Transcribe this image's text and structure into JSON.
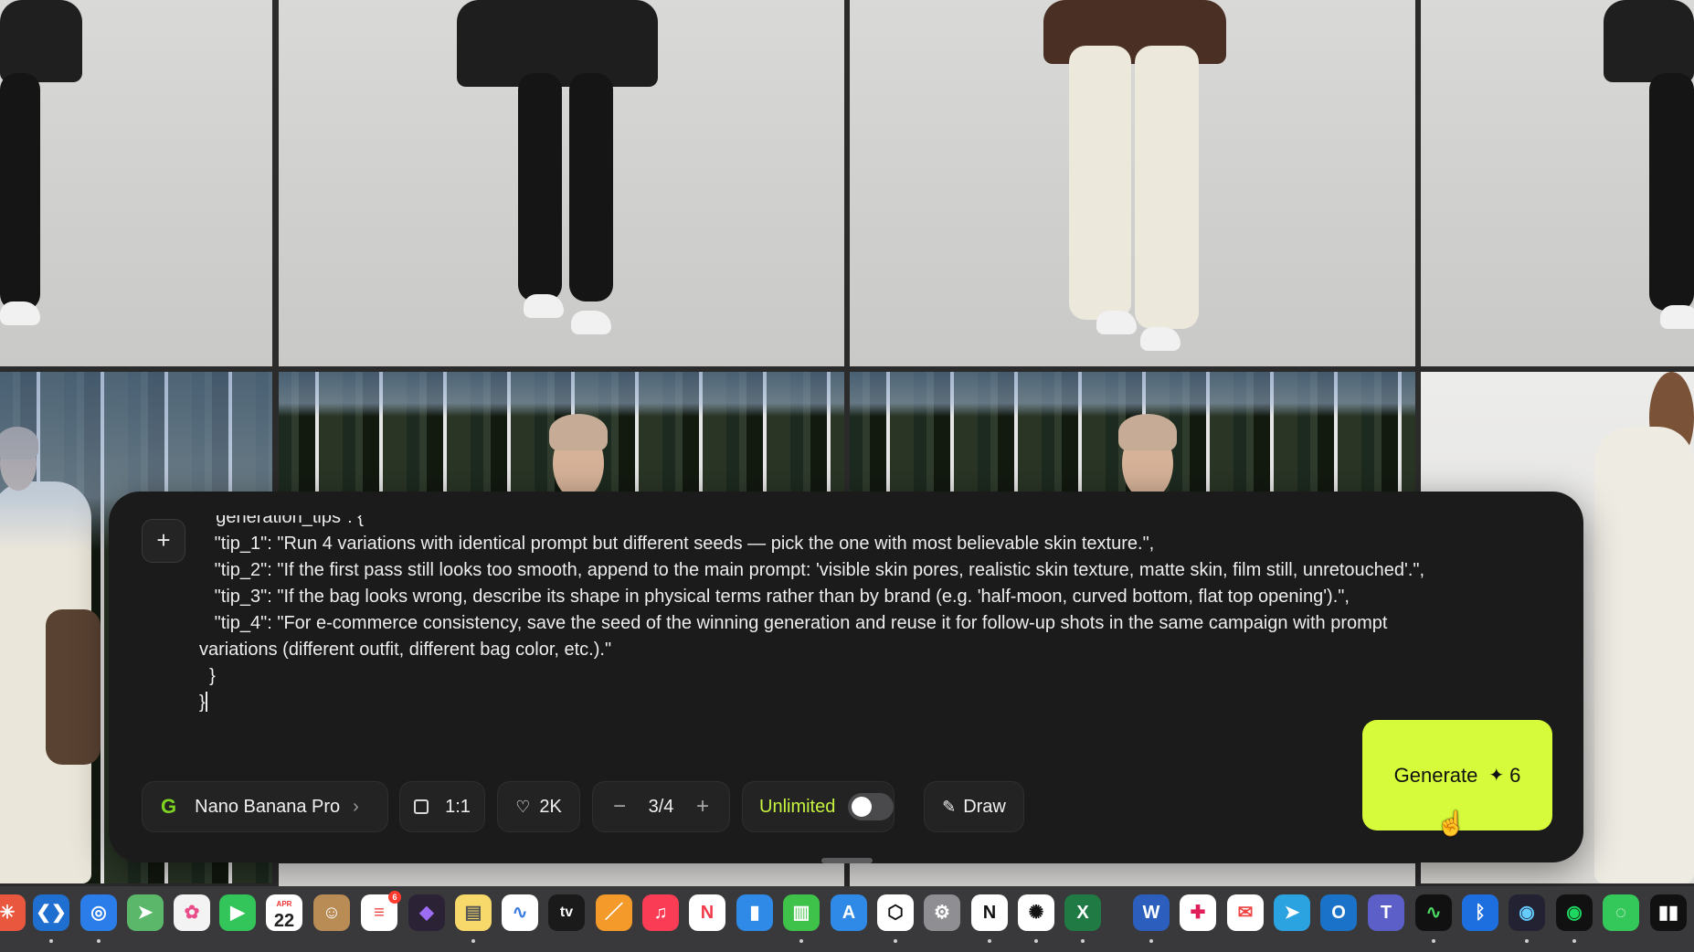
{
  "prompt": {
    "add_label": "+",
    "text": "  \"generation_tips\": {\n   \"tip_1\": \"Run 4 variations with identical prompt but different seeds — pick the one with most believable skin texture.\",\n   \"tip_2\": \"If the first pass still looks too smooth, append to the main prompt: 'visible skin pores, realistic skin texture, matte skin, film still, unretouched'.\",\n   \"tip_3\": \"If the bag looks wrong, describe its shape in physical terms rather than by brand (e.g. 'half-moon, curved bottom, flat top opening').\",\n   \"tip_4\": \"For e-commerce consistency, save the seed of the winning generation and reuse it for follow-up shots in the same campaign with prompt variations (different outfit, different bag color, etc.).\"\n  }\n}"
  },
  "toolbar": {
    "model_glyph": "G",
    "model": "Nano Banana Pro",
    "model_chevron": "›",
    "ratio": "1:1",
    "resolution_icon": "♡",
    "resolution": "2K",
    "count_minus": "−",
    "count": "3/4",
    "count_plus": "+",
    "unlimited_label": "Unlimited",
    "unlimited_on": false,
    "draw_icon": "✎",
    "draw_label": "Draw"
  },
  "generate": {
    "label": "Generate",
    "spark": "✦",
    "cost": "6"
  },
  "dock": {
    "calendar_month": "APR",
    "calendar_day": "22",
    "reminders_badge": "6",
    "tv_label": "tv",
    "icons": [
      "launchpad-icon",
      "vscode-icon",
      "chromium-icon",
      "maps-icon",
      "photos-icon",
      "facetime-icon",
      "calendar-icon",
      "contacts-icon",
      "reminders-icon",
      "obsidian-icon",
      "notes-icon",
      "freeform-icon",
      "appletv-icon",
      "pages-icon",
      "music-icon",
      "news-icon",
      "keynote-icon",
      "numbers-icon",
      "appstore-icon",
      "blender-icon",
      "settings-icon",
      "notion-icon",
      "chatgpt-icon",
      "excel-icon",
      "word-icon",
      "slack-icon",
      "airmail-icon",
      "telegram-icon",
      "outlook-icon",
      "teams-icon",
      "activity-monitor-icon",
      "bluetooth-icon",
      "proxyman-icon",
      "spotify-icon",
      "messages-icon",
      "stocks-icon"
    ]
  },
  "colors": {
    "accent": "#d6fb3a",
    "panel": "#1b1b1c",
    "unlimited": "#c6f240"
  }
}
